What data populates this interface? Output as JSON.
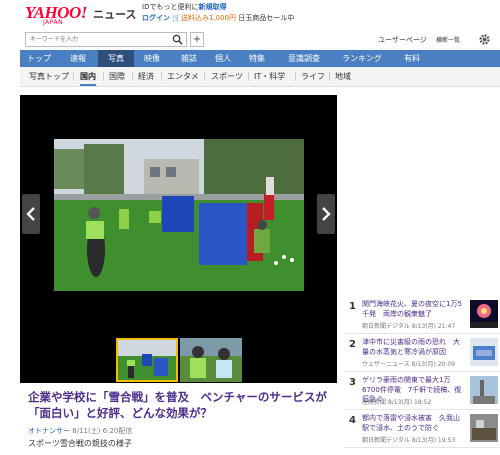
{
  "header": {
    "logo": "YAHOO!",
    "logo_sub": "JAPAN",
    "service": "ニュース",
    "promo_line1_prefix": "IDでもっと便利に",
    "promo_line1_link": "新規取得",
    "login": "ログイン",
    "cart_text": "送料込み1,000円",
    "sale_text": "日玉商品セール中"
  },
  "search": {
    "placeholder": "キーワードを入力",
    "add_label": "+",
    "user_page": "ユーザーページ",
    "all_services": "横断一覧"
  },
  "nav": {
    "items": [
      "トップ",
      "速報",
      "写真",
      "映像",
      "雑誌",
      "個人",
      "特集",
      "意識調査",
      "ランキング",
      "有料"
    ],
    "active_index": 2
  },
  "subnav": {
    "items": [
      "写真トップ",
      "国内",
      "国際",
      "経済",
      "エンタメ",
      "スポーツ",
      "IT・科学",
      "ライフ",
      "地域"
    ],
    "active_index": 1
  },
  "article": {
    "title": "企業や学校に「雪合戦」を普及　ベンチャーのサービスが「面白い」と好評、どんな効果が？",
    "source": "オトナンサー",
    "date": "8/11(土) 6:20配信",
    "caption": "スポーツ雪合戦の競技の様子"
  },
  "ranking": [
    {
      "num": "1",
      "text": "関門海峡花火、夏の夜空に1万5千発　両岸の観衆魅了",
      "source": "朝日新聞デジタル",
      "time": "8/13(月) 21:47"
    },
    {
      "num": "2",
      "text": "津中市に災害級の雨の恐れ　大量の水蒸気と寒冷渦が原因",
      "source": "ウェザーニュース",
      "time": "8/13(月) 20:09"
    },
    {
      "num": "3",
      "text": "ゲリラ豪雨の関東で最大1万6700件停電　7千軒で続稿、復旧急ぐ",
      "source": "産経新聞",
      "time": "8/13(月) 18:52"
    },
    {
      "num": "4",
      "text": "都内で落雷や浸水被害　久我山駅で浸水、土のうで防ぐ",
      "source": "朝日新聞デジタル",
      "time": "8/13(月) 19:53"
    }
  ],
  "colors": {
    "nav_bg": "#4a7fc1",
    "nav_active": "#2c4f7c",
    "title_purple": "#4b2c8f",
    "link_blue": "#1a64c8",
    "thumb_selected": "#f0c000",
    "logo_red": "#ff0033"
  }
}
